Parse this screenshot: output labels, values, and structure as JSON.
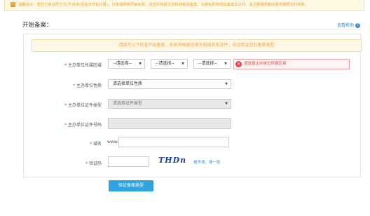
{
  "tip": {
    "icon": "warning-icon",
    "text": "温馨提示：若您已有合同方式(不含续)至提交开始计算)，订单或网络同来失败，请您尽快提交资料并完成备案。为避免影响网站备案及访问，请主要服务器的服务期限及时续费。"
  },
  "section_title": "开始备案：",
  "help_link": "查看帮助",
  "notice": "请填写以下信息开始备案，系统将根据您填写的域名和证件，自动验证您的备案类型",
  "form": {
    "region": {
      "label": "主办单位所属区域",
      "province": "--请选择--",
      "city": "--请选择--",
      "district": "--请选择--",
      "error": "请选择主办单位所属区县"
    },
    "nature": {
      "label": "主办单位性质",
      "value": "请选择单位性质"
    },
    "cert_type": {
      "label": "主办单位证件类型",
      "value": "请选择证件类型"
    },
    "cert_no": {
      "label": "主办单位证件号码",
      "value": ""
    },
    "domain": {
      "label": "域名",
      "prefix": "www.",
      "value": ""
    },
    "captcha": {
      "label": "验证码",
      "value": "",
      "image_text": "THDn",
      "refresh": "看不清，换一张"
    }
  },
  "submit_label": "验证备案类型",
  "colors": {
    "accent": "#2fa4e0",
    "error": "#e24b4b",
    "warning": "#f0a14a"
  }
}
